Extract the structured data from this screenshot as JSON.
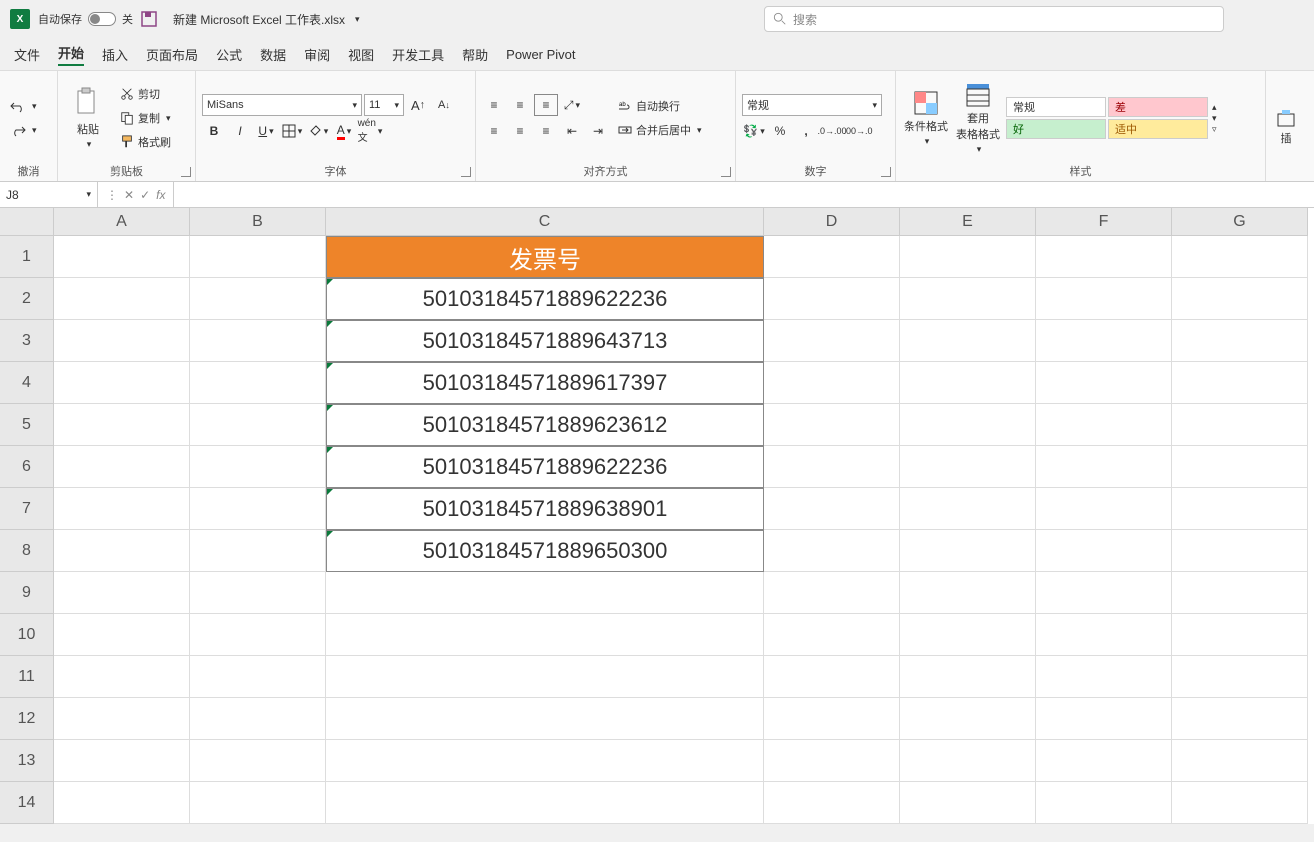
{
  "title": {
    "autosave": "自动保存",
    "autosave_state": "关",
    "filename": "新建 Microsoft Excel 工作表.xlsx"
  },
  "search": {
    "placeholder": "搜索"
  },
  "menu": {
    "file": "文件",
    "home": "开始",
    "insert": "插入",
    "layout": "页面布局",
    "formulas": "公式",
    "data": "数据",
    "review": "审阅",
    "view": "视图",
    "dev": "开发工具",
    "help": "帮助",
    "powerpivot": "Power Pivot"
  },
  "ribbon": {
    "undo_group": "撤消",
    "clipboard": {
      "paste": "粘贴",
      "cut": "剪切",
      "copy": "复制",
      "formatpainter": "格式刷",
      "label": "剪贴板"
    },
    "font": {
      "name": "MiSans",
      "size": "11",
      "label": "字体"
    },
    "align": {
      "wrap": "自动换行",
      "merge": "合并后居中",
      "label": "对齐方式"
    },
    "number": {
      "format": "常规",
      "label": "数字"
    },
    "styles": {
      "condfmt": "条件格式",
      "tablefmt": "套用\n表格格式",
      "normal": "常规",
      "bad": "差",
      "good": "好",
      "neutral": "适中",
      "label": "样式"
    },
    "cells": {
      "insert": "插"
    }
  },
  "namebox": "J8",
  "sheet": {
    "columns": [
      "A",
      "B",
      "C",
      "D",
      "E",
      "F",
      "G"
    ],
    "header": "发票号",
    "data": [
      "50103184571889622236",
      "50103184571889643713",
      "50103184571889617397",
      "50103184571889623612",
      "50103184571889622236",
      "50103184571889638901",
      "50103184571889650300"
    ],
    "rowcount": 14
  }
}
